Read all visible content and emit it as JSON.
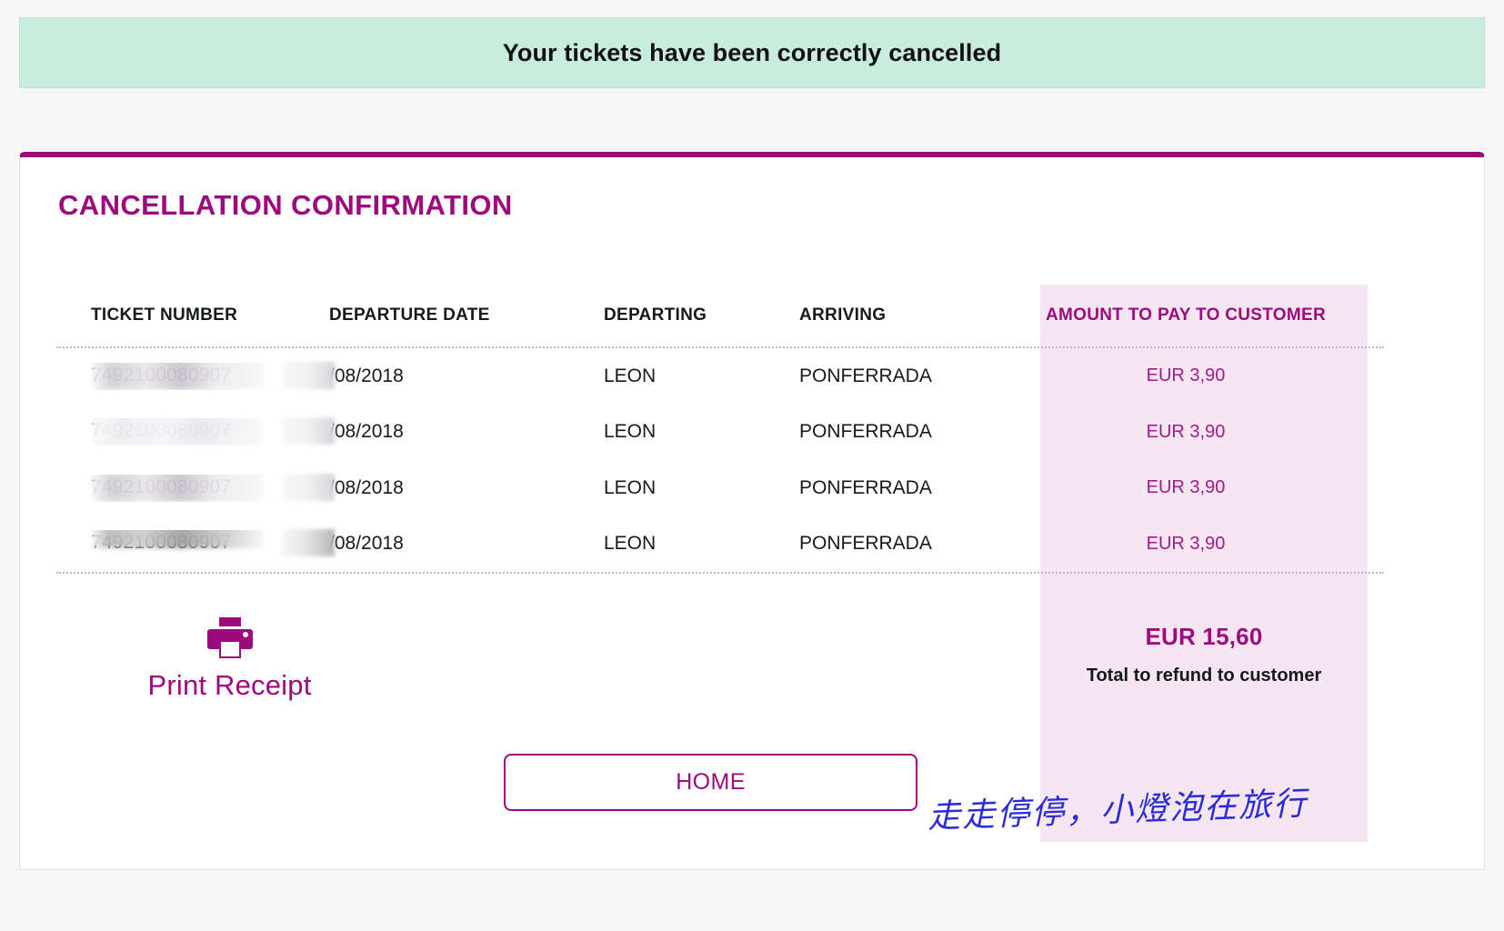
{
  "banner": {
    "message": "Your tickets have been correctly cancelled",
    "background_color": "#c8ecdd"
  },
  "card": {
    "title": "CANCELLATION CONFIRMATION",
    "accent_color": "#9c0a7d",
    "highlight_background": "#f5e6f2"
  },
  "table": {
    "headers": {
      "ticket_number": "TICKET NUMBER",
      "departure_date": "DEPARTURE DATE",
      "departing": "DEPARTING",
      "arriving": "ARRIVING",
      "amount": "AMOUNT TO PAY TO CUSTOMER"
    },
    "rows": [
      {
        "ticket_number": "7492100080907",
        "ticket_number_redacted": true,
        "departure_date": "/08/2018",
        "departing": "LEON",
        "arriving": "PONFERRADA",
        "amount": "EUR 3,90"
      },
      {
        "ticket_number": "7492100080907",
        "ticket_number_redacted": true,
        "departure_date": "/08/2018",
        "departing": "LEON",
        "arriving": "PONFERRADA",
        "amount": "EUR 3,90"
      },
      {
        "ticket_number": "7492100080907",
        "ticket_number_redacted": true,
        "departure_date": "/08/2018",
        "departing": "LEON",
        "arriving": "PONFERRADA",
        "amount": "EUR 3,90"
      },
      {
        "ticket_number": "7492100080907",
        "ticket_number_redacted": true,
        "departure_date": "/08/2018",
        "departing": "LEON",
        "arriving": "PONFERRADA",
        "amount": "EUR 3,90"
      }
    ]
  },
  "total": {
    "amount": "EUR 15,60",
    "caption": "Total to refund to customer"
  },
  "actions": {
    "print_receipt_label": "Print Receipt",
    "print_icon": "printer-icon",
    "home_label": "HOME"
  },
  "watermark": {
    "text": "走走停停，小燈泡在旅行",
    "color": "#2b2bd8"
  }
}
